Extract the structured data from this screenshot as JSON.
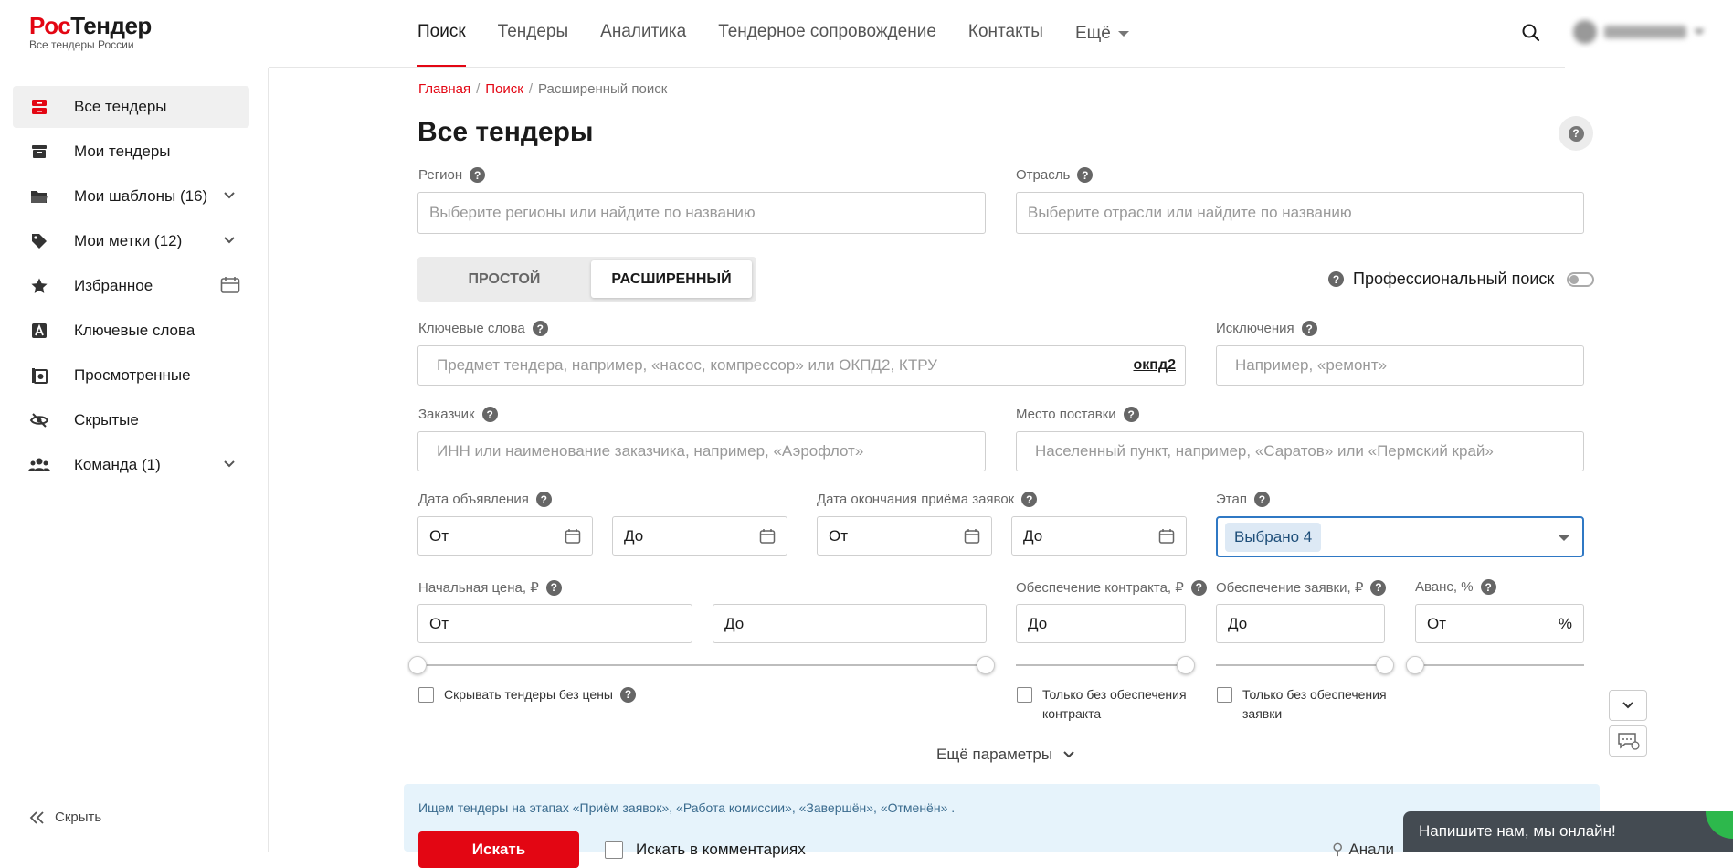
{
  "brand": {
    "part1": "Рос",
    "part2": "Тендер",
    "tagline": "Все тендеры России"
  },
  "nav": {
    "items": [
      "Поиск",
      "Тендеры",
      "Аналитика",
      "Тендерное сопровождение",
      "Контакты"
    ],
    "more": "Ещё"
  },
  "sidebar": {
    "items": [
      {
        "label": "Все тендеры",
        "icon": "all-tenders-icon"
      },
      {
        "label": "Мои тендеры",
        "icon": "my-tenders-icon"
      },
      {
        "label": "Мои шаблоны (16)",
        "icon": "folder-icon"
      },
      {
        "label": "Мои метки (12)",
        "icon": "tag-icon"
      },
      {
        "label": "Избранное",
        "icon": "star-icon"
      },
      {
        "label": "Ключевые слова",
        "icon": "keyword-icon"
      },
      {
        "label": "Просмотренные",
        "icon": "viewed-icon"
      },
      {
        "label": "Скрытые",
        "icon": "hidden-icon"
      },
      {
        "label": "Команда (1)",
        "icon": "team-icon"
      }
    ],
    "hide": "Скрыть"
  },
  "breadcrumb": {
    "home": "Главная",
    "search": "Поиск",
    "current": "Расширенный поиск",
    "sep": "/"
  },
  "title": "Все тендеры",
  "form": {
    "region": {
      "label": "Регион",
      "placeholder": "Выберите регионы или найдите по названию"
    },
    "industry": {
      "label": "Отрасль",
      "placeholder": "Выберите отрасли или найдите по названию"
    },
    "mode": {
      "simple": "ПРОСТОЙ",
      "advanced": "РАСШИРЕННЫЙ"
    },
    "pro": "Профессиональный поиск",
    "keywords": {
      "label": "Ключевые слова",
      "placeholder": "Предмет тендера, например, «насос, компрессор» или ОКПД2, КТРУ",
      "link": "окпд2"
    },
    "exclusions": {
      "label": "Исключения",
      "placeholder": "Например, «ремонт»"
    },
    "customer": {
      "label": "Заказчик",
      "placeholder": "ИНН или наименование заказчика, например, «Аэрофлот»"
    },
    "delivery": {
      "label": "Место поставки",
      "placeholder": "Населенный пункт, например, «Саратов» или «Пермский край»"
    },
    "pubdate": {
      "label": "Дата объявления",
      "from": "От",
      "to": "До"
    },
    "enddate": {
      "label": "Дата окончания приёма заявок",
      "from": "От",
      "to": "До"
    },
    "stage": {
      "label": "Этап",
      "value": "Выбрано 4"
    },
    "price": {
      "label": "Начальная цена, ₽",
      "from": "От",
      "to": "До"
    },
    "contract_sec": {
      "label": "Обеспечение контракта, ₽",
      "to": "До"
    },
    "app_sec": {
      "label": "Обеспечение заявки, ₽",
      "to": "До"
    },
    "advance": {
      "label": "Аванс, %",
      "from": "От",
      "unit": "%"
    },
    "hide_no_price": "Скрывать тендеры без цены",
    "only_no_contract_1": "Только без обеспечения",
    "only_no_contract_2": "контракта",
    "only_no_app_1": "Только без обеспечения",
    "only_no_app_2": "заявки",
    "more_params": "Ещё параметры"
  },
  "banner": {
    "text": "Ищем тендеры на этапах «Приём заявок», «Работа комиссии», «Завершён», «Отменён» .",
    "search_btn": "Искать",
    "comments": "Искать в комментариях",
    "analytics": "Анали"
  },
  "chat": "Напишите нам, мы онлайн!"
}
